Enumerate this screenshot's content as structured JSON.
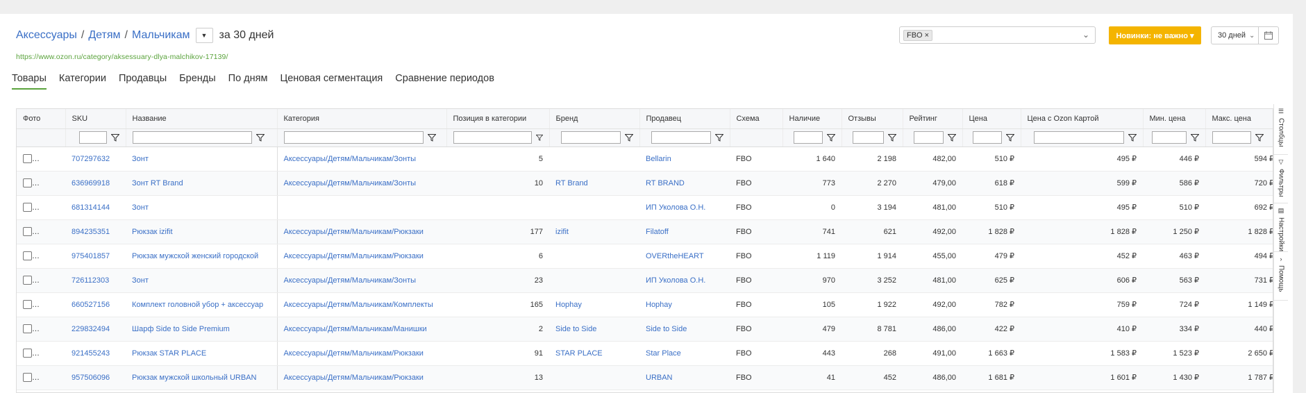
{
  "header": {
    "breadcrumbs": [
      "Аксессуары",
      "Детям",
      "Мальчикам"
    ],
    "period_text": "за 30 дней",
    "url": "https://www.ozon.ru/category/aksessuary-dlya-malchikov-17139/",
    "filter_chip": "FBO ×",
    "novelty_button": "Новинки: не важно ▾",
    "days_select": "30 дней"
  },
  "tabs": [
    "Товары",
    "Категории",
    "Продавцы",
    "Бренды",
    "По дням",
    "Ценовая сегментация",
    "Сравнение периодов"
  ],
  "table": {
    "columns": [
      "Фото",
      "SKU",
      "Название",
      "Категория",
      "Позиция в категории",
      "Бренд",
      "Продавец",
      "Схема",
      "Наличие",
      "Отзывы",
      "Рейтинг",
      "Цена",
      "Цена с Ozon Картой",
      "Мин. цена",
      "Макс. цена"
    ],
    "rows": [
      {
        "sku": "707297632",
        "name": "Зонт",
        "category": "Аксессуары/Детям/Мальчикам/Зонты",
        "position": "5",
        "brand": "",
        "seller": "Bellarin",
        "scheme": "FBO",
        "stock": "1 640",
        "reviews": "2 198",
        "rating": "482,00",
        "price": "510 ₽",
        "ozon_price": "495 ₽",
        "min_price": "446 ₽",
        "max_price": "594 ₽"
      },
      {
        "sku": "636969918",
        "name": "Зонт RT Brand",
        "category": "Аксессуары/Детям/Мальчикам/Зонты",
        "position": "10",
        "brand": "RT Brand",
        "seller": "RT BRAND",
        "scheme": "FBO",
        "stock": "773",
        "reviews": "2 270",
        "rating": "479,00",
        "price": "618 ₽",
        "ozon_price": "599 ₽",
        "min_price": "586 ₽",
        "max_price": "720 ₽"
      },
      {
        "sku": "681314144",
        "name": "Зонт",
        "category": "",
        "position": "",
        "brand": "",
        "seller": "ИП Уколова О.Н.",
        "scheme": "FBO",
        "stock": "0",
        "reviews": "3 194",
        "rating": "481,00",
        "price": "510 ₽",
        "ozon_price": "495 ₽",
        "min_price": "510 ₽",
        "max_price": "692 ₽"
      },
      {
        "sku": "894235351",
        "name": "Рюкзак izifit",
        "category": "Аксессуары/Детям/Мальчикам/Рюкзаки",
        "position": "177",
        "brand": "izifit",
        "seller": "Filatoff",
        "scheme": "FBO",
        "stock": "741",
        "reviews": "621",
        "rating": "492,00",
        "price": "1 828 ₽",
        "ozon_price": "1 828 ₽",
        "min_price": "1 250 ₽",
        "max_price": "1 828 ₽"
      },
      {
        "sku": "975401857",
        "name": "Рюкзак мужской женский городской",
        "category": "Аксессуары/Детям/Мальчикам/Рюкзаки",
        "position": "6",
        "brand": "",
        "seller": "OVERtheHEART",
        "scheme": "FBO",
        "stock": "1 119",
        "reviews": "1 914",
        "rating": "455,00",
        "price": "479 ₽",
        "ozon_price": "452 ₽",
        "min_price": "463 ₽",
        "max_price": "494 ₽"
      },
      {
        "sku": "726112303",
        "name": "Зонт",
        "category": "Аксессуары/Детям/Мальчикам/Зонты",
        "position": "23",
        "brand": "",
        "seller": "ИП Уколова О.Н.",
        "scheme": "FBO",
        "stock": "970",
        "reviews": "3 252",
        "rating": "481,00",
        "price": "625 ₽",
        "ozon_price": "606 ₽",
        "min_price": "563 ₽",
        "max_price": "731 ₽"
      },
      {
        "sku": "660527156",
        "name": "Комплект головной убор + аксессуар",
        "category": "Аксессуары/Детям/Мальчикам/Комплекты",
        "position": "165",
        "brand": "Hophay",
        "seller": "Hophay",
        "scheme": "FBO",
        "stock": "105",
        "reviews": "1 922",
        "rating": "492,00",
        "price": "782 ₽",
        "ozon_price": "759 ₽",
        "min_price": "724 ₽",
        "max_price": "1 149 ₽"
      },
      {
        "sku": "229832494",
        "name": "Шарф Side to Side Premium",
        "category": "Аксессуары/Детям/Мальчикам/Манишки",
        "position": "2",
        "brand": "Side to Side",
        "seller": "Side to Side",
        "scheme": "FBO",
        "stock": "479",
        "reviews": "8 781",
        "rating": "486,00",
        "price": "422 ₽",
        "ozon_price": "410 ₽",
        "min_price": "334 ₽",
        "max_price": "440 ₽"
      },
      {
        "sku": "921455243",
        "name": "Рюкзак STAR PLACE",
        "category": "Аксессуары/Детям/Мальчикам/Рюкзаки",
        "position": "91",
        "brand": "STAR PLACE",
        "seller": "Star Place",
        "scheme": "FBO",
        "stock": "443",
        "reviews": "268",
        "rating": "491,00",
        "price": "1 663 ₽",
        "ozon_price": "1 583 ₽",
        "min_price": "1 523 ₽",
        "max_price": "2 650 ₽"
      },
      {
        "sku": "957506096",
        "name": "Рюкзак мужской школьный URBAN",
        "category": "Аксессуары/Детям/Мальчикам/Рюкзаки",
        "position": "13",
        "brand": "",
        "seller": "URBAN",
        "scheme": "FBO",
        "stock": "41",
        "reviews": "452",
        "rating": "486,00",
        "price": "1 681 ₽",
        "ozon_price": "1 601 ₽",
        "min_price": "1 430 ₽",
        "max_price": "1 787 ₽"
      }
    ]
  },
  "sidebar": [
    "Столбцы",
    "Фильтры",
    "Настройки",
    "Помощь"
  ],
  "colors": {
    "accent_green": "#5aa33c",
    "link_blue": "#3a6fc6",
    "novelty_yellow": "#f4b400"
  }
}
